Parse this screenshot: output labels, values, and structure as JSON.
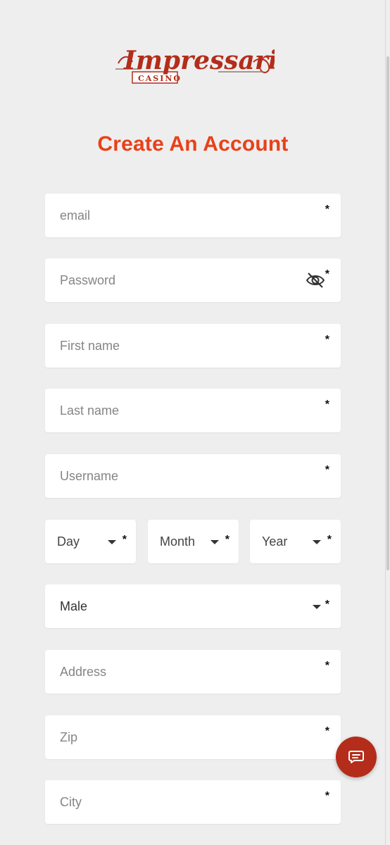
{
  "brand": {
    "name": "Impressario",
    "sub": "CASINO",
    "primary_color": "#b32d1a",
    "accent_color": "#e84119"
  },
  "page_title": "Create An Account",
  "required_mark": "*",
  "fields": {
    "email": {
      "placeholder": "email"
    },
    "password": {
      "placeholder": "Password",
      "toggle_icon": "eye-slash-icon"
    },
    "first_name": {
      "placeholder": "First name"
    },
    "last_name": {
      "placeholder": "Last name"
    },
    "username": {
      "placeholder": "Username"
    },
    "address": {
      "placeholder": "Address"
    },
    "zip": {
      "placeholder": "Zip"
    },
    "city": {
      "placeholder": "City"
    }
  },
  "dob": {
    "day": {
      "value": "Day"
    },
    "month": {
      "value": "Month"
    },
    "year": {
      "value": "Year"
    }
  },
  "gender": {
    "value": "Male"
  },
  "chat": {
    "icon": "chat-icon"
  }
}
